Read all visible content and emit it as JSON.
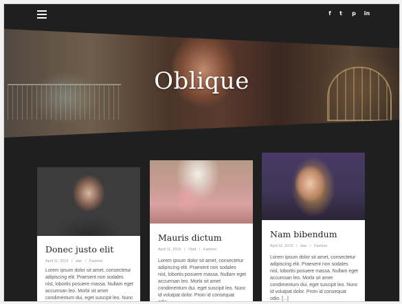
{
  "header": {
    "site_title": "Oblique",
    "social": [
      {
        "name": "facebook",
        "glyph": "f"
      },
      {
        "name": "twitter",
        "glyph": "t"
      },
      {
        "name": "pinterest",
        "glyph": "p"
      },
      {
        "name": "linkedin",
        "glyph": "in"
      }
    ]
  },
  "posts": [
    {
      "title": "Donec justo elit",
      "date": "April 11, 2015",
      "author": "dan",
      "category": "Fashion",
      "excerpt": "Lorem ipsum dolor sit amet, consectetur adipiscing elit. Praesent non sodales nisl, lobortis posuere massa. Nullam eget accumsan leo. Morbi sit amet condimentum dui, eget suscipit leo. Nunc"
    },
    {
      "title": "Mauris dictum",
      "date": "April 11, 2015",
      "author": "Vlad",
      "category": "Fashion",
      "excerpt": "Lorem ipsum dolor sit amet, consectetur adipiscing elit. Praesent non sodales nisl, lobortis posuere massa. Nullam eget accumsan leo. Morbi sit amet condimentum dui, eget suscipit leo. Nunc id volutpat dolor. Proin id consequat odio."
    },
    {
      "title": "Nam bibendum",
      "date": "April 11, 2015",
      "author": "dan",
      "category": "Fashion",
      "excerpt": "Lorem ipsum dolor sit amet, consectetur adipiscing elit. Praesent non sodales nisl, lobortis posuere massa. Nullam eget accumsan leo. Morbi sit amet condimentum dui, eget suscipit leo. Nunc id volutpat dolor. Proin id consequat odio. [...]"
    }
  ],
  "meta_separator": "/",
  "colors": {
    "background": "#1f1f1f",
    "card": "#ffffff",
    "title": "#ffffff"
  }
}
